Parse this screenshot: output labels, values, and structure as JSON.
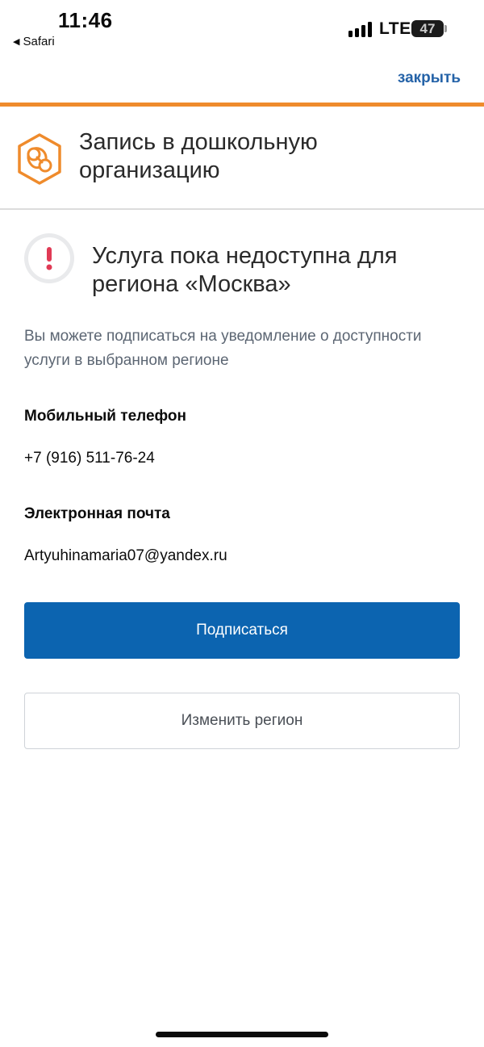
{
  "status_bar": {
    "time": "11:46",
    "back_app": "Safari",
    "network": "LTE",
    "battery": "47",
    "battery_fraction": 0.47
  },
  "top_bar": {
    "close_label": "закрыть",
    "accent_color": "#ef8b2c",
    "link_color": "#2563a8"
  },
  "service": {
    "title": "Запись в дошкольную организацию",
    "icon": "pacifier-icon"
  },
  "alert": {
    "icon": "exclamation-icon",
    "title": "Услуга пока недоступна для региона «Москва»",
    "description": "Вы можете подписаться на уведомление о доступности услуги в выбранном регионе"
  },
  "form": {
    "phone_label": "Мобильный телефон",
    "phone_value": "+7 (916) 511-76-24",
    "email_label": "Электронная почта",
    "email_value": "Artyuhinamaria07@yandex.ru"
  },
  "actions": {
    "subscribe_label": "Подписаться",
    "change_region_label": "Изменить регион",
    "primary_color": "#0c64b0"
  }
}
